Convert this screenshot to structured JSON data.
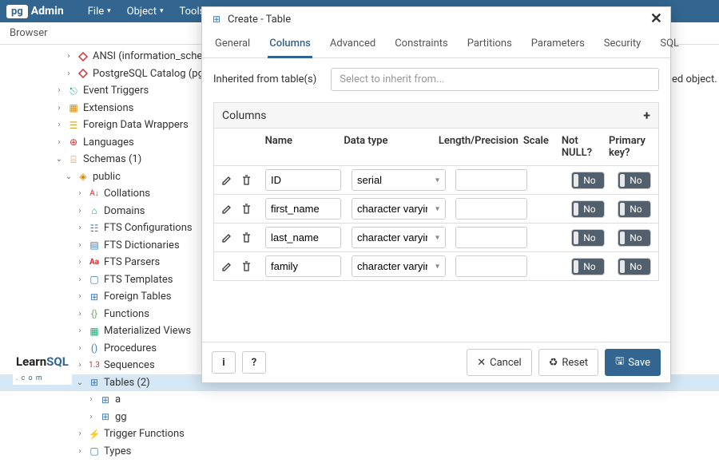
{
  "brand": {
    "logo": "pg",
    "admin": "Admin"
  },
  "menubar": {
    "file": "File",
    "object": "Object",
    "tools": "Tools"
  },
  "browser": {
    "title": "Browser"
  },
  "tree": {
    "ansi": "ANSI (information_schem",
    "pgcatalog": "PostgreSQL Catalog (pg_c",
    "eventTriggers": "Event Triggers",
    "extensions": "Extensions",
    "fdw": "Foreign Data Wrappers",
    "languages": "Languages",
    "schemas": "Schemas (1)",
    "public": "public",
    "collations": "Collations",
    "domains": "Domains",
    "ftsConfig": "FTS Configurations",
    "ftsDict": "FTS Dictionaries",
    "ftsParsers": "FTS Parsers",
    "ftsTemplates": "FTS Templates",
    "foreignTables": "Foreign Tables",
    "functions": "Functions",
    "matViews": "Materialized Views",
    "procedures": "Procedures",
    "sequences": "Sequences",
    "tables": "Tables (2)",
    "tbl_a": "a",
    "tbl_gg": "gg",
    "triggerFns": "Trigger Functions",
    "types": "Types"
  },
  "dialog": {
    "title": "Create - Table",
    "tabs": {
      "general": "General",
      "columns": "Columns",
      "advanced": "Advanced",
      "constraints": "Constraints",
      "partitions": "Partitions",
      "parameters": "Parameters",
      "security": "Security",
      "sql": "SQL"
    },
    "inherited_label": "Inherited from table(s)",
    "inherited_placeholder": "Select to inherit from...",
    "columns_heading": "Columns",
    "headers": {
      "name": "Name",
      "type": "Data type",
      "length": "Length/Precision",
      "scale": "Scale",
      "notnull": "Not NULL?",
      "pk": "Primary key?"
    },
    "rows": [
      {
        "name": "ID",
        "type": "serial",
        "notnull": "No",
        "pk": "No"
      },
      {
        "name": "first_name",
        "type": "character varying",
        "notnull": "No",
        "pk": "No"
      },
      {
        "name": "last_name",
        "type": "character varying",
        "notnull": "No",
        "pk": "No"
      },
      {
        "name": "family",
        "type": "character varying",
        "notnull": "No",
        "pk": "No"
      }
    ],
    "footer": {
      "info": "i",
      "help": "?",
      "cancel": "Cancel",
      "reset": "Reset",
      "save": "Save"
    }
  },
  "side_text": "ed object.",
  "watermark": {
    "learn": "Learn",
    "sql": "SQL",
    "com": ". c o m"
  }
}
